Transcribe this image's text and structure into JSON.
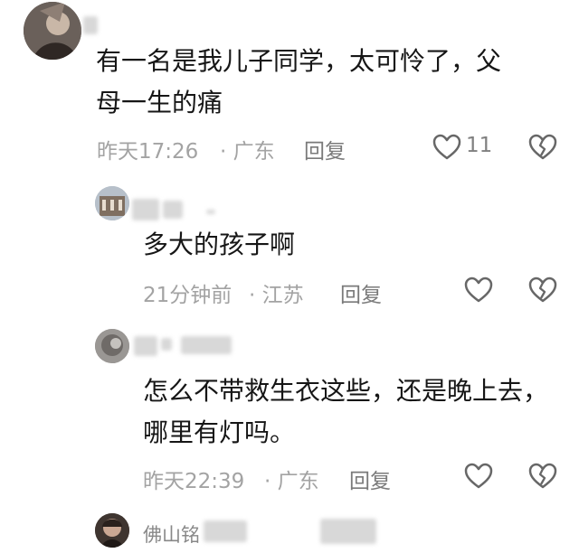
{
  "comments": [
    {
      "text": "有一名是我儿子同学，太可怜了，父\n母一生的痛",
      "time": "昨天17:26",
      "location": "· 广东",
      "reply_label": "回复",
      "like_count": "11"
    },
    {
      "text": "多大的孩子啊",
      "time": "21分钟前",
      "location": "· 江苏",
      "reply_label": "回复"
    },
    {
      "text": "怎么不带救生衣这些，还是晚上去，\n哪里有灯吗。",
      "time": "昨天22:39",
      "location": "· 广东",
      "reply_label": "回复"
    },
    {
      "username": "佛山铭"
    }
  ]
}
